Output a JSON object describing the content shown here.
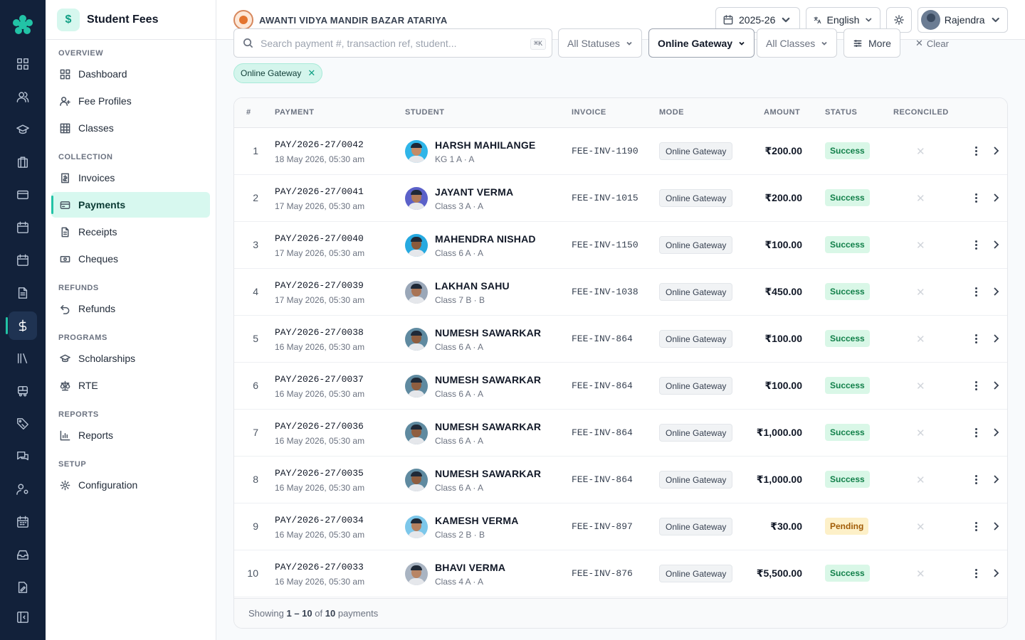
{
  "app": {
    "section_title": "Student Fees",
    "section_icon": "$"
  },
  "school": {
    "name": "AWANTI VIDYA MANDIR BAZAR ATARIYA"
  },
  "header": {
    "year": "2025-26",
    "language": "English",
    "user": "Rajendra"
  },
  "rail_icons": [
    "grid-icon",
    "users-icon",
    "graduation-cap-icon",
    "building-icon",
    "card-icon",
    "calendar-icon",
    "calendar-check-icon",
    "document-icon",
    "dollar-icon",
    "library-icon",
    "bus-icon",
    "tag-icon",
    "chat-icon",
    "user-gear-icon",
    "timetable-icon",
    "inbox-icon",
    "file-edit-icon",
    "collapse-icon"
  ],
  "sidebar": {
    "sections": {
      "overview": "OVERVIEW",
      "collection": "COLLECTION",
      "refunds": "REFUNDS",
      "programs": "PROGRAMS",
      "reports": "REPORTS",
      "setup": "SETUP"
    },
    "items": {
      "dashboard": "Dashboard",
      "fee_profiles": "Fee Profiles",
      "classes": "Classes",
      "invoices": "Invoices",
      "payments": "Payments",
      "receipts": "Receipts",
      "cheques": "Cheques",
      "refunds": "Refunds",
      "scholarships": "Scholarships",
      "rte": "RTE",
      "reports": "Reports",
      "configuration": "Configuration"
    }
  },
  "filters": {
    "search_placeholder": "Search payment #, transaction ref, student...",
    "search_shortcut": "⌘K",
    "status": "All Statuses",
    "mode": "Online Gateway",
    "classes": "All Classes",
    "more": "More",
    "clear": "Clear",
    "active_chip": "Online Gateway"
  },
  "table": {
    "columns": {
      "num": "#",
      "payment": "PAYMENT",
      "student": "STUDENT",
      "invoice": "INVOICE",
      "mode": "MODE",
      "amount": "AMOUNT",
      "status": "STATUS",
      "reconciled": "RECONCILED"
    },
    "rows": [
      {
        "n": "1",
        "pay": "PAY/2026-27/0042",
        "date": "18 May 2026, 05:30 am",
        "name": "HARSH MAHILANGE",
        "cls": "KG 1 A · A",
        "inv": "FEE-INV-1190",
        "mode": "Online Gateway",
        "amt": "₹200.00",
        "status": "Success",
        "bg": "#2fb5e8",
        "skin": "#c48c67"
      },
      {
        "n": "2",
        "pay": "PAY/2026-27/0041",
        "date": "17 May 2026, 05:30 am",
        "name": "JAYANT VERMA",
        "cls": "Class 3 A · A",
        "inv": "FEE-INV-1015",
        "mode": "Online Gateway",
        "amt": "₹200.00",
        "status": "Success",
        "bg": "#5b61c9",
        "skin": "#b07a58"
      },
      {
        "n": "3",
        "pay": "PAY/2026-27/0040",
        "date": "17 May 2026, 05:30 am",
        "name": "MAHENDRA NISHAD",
        "cls": "Class 6 A · A",
        "inv": "FEE-INV-1150",
        "mode": "Online Gateway",
        "amt": "₹100.00",
        "status": "Success",
        "bg": "#26a9e0",
        "skin": "#8a5a3c"
      },
      {
        "n": "4",
        "pay": "PAY/2026-27/0039",
        "date": "17 May 2026, 05:30 am",
        "name": "LAKHAN SAHU",
        "cls": "Class 7 B · B",
        "inv": "FEE-INV-1038",
        "mode": "Online Gateway",
        "amt": "₹450.00",
        "status": "Success",
        "bg": "#9aa7b8",
        "skin": "#a97455"
      },
      {
        "n": "5",
        "pay": "PAY/2026-27/0038",
        "date": "16 May 2026, 05:30 am",
        "name": "NUMESH SAWARKAR",
        "cls": "Class 6 A · A",
        "inv": "FEE-INV-864",
        "mode": "Online Gateway",
        "amt": "₹100.00",
        "status": "Success",
        "bg": "#5f8aa0",
        "skin": "#8f5e40"
      },
      {
        "n": "6",
        "pay": "PAY/2026-27/0037",
        "date": "16 May 2026, 05:30 am",
        "name": "NUMESH SAWARKAR",
        "cls": "Class 6 A · A",
        "inv": "FEE-INV-864",
        "mode": "Online Gateway",
        "amt": "₹100.00",
        "status": "Success",
        "bg": "#5f8aa0",
        "skin": "#8f5e40"
      },
      {
        "n": "7",
        "pay": "PAY/2026-27/0036",
        "date": "16 May 2026, 05:30 am",
        "name": "NUMESH SAWARKAR",
        "cls": "Class 6 A · A",
        "inv": "FEE-INV-864",
        "mode": "Online Gateway",
        "amt": "₹1,000.00",
        "status": "Success",
        "bg": "#5f8aa0",
        "skin": "#8f5e40"
      },
      {
        "n": "8",
        "pay": "PAY/2026-27/0035",
        "date": "16 May 2026, 05:30 am",
        "name": "NUMESH SAWARKAR",
        "cls": "Class 6 A · A",
        "inv": "FEE-INV-864",
        "mode": "Online Gateway",
        "amt": "₹1,000.00",
        "status": "Success",
        "bg": "#5f8aa0",
        "skin": "#8f5e40"
      },
      {
        "n": "9",
        "pay": "PAY/2026-27/0034",
        "date": "16 May 2026, 05:30 am",
        "name": "KAMESH VERMA",
        "cls": "Class 2 B · B",
        "inv": "FEE-INV-897",
        "mode": "Online Gateway",
        "amt": "₹30.00",
        "status": "Pending",
        "bg": "#7cc7ea",
        "skin": "#b58160"
      },
      {
        "n": "10",
        "pay": "PAY/2026-27/0033",
        "date": "16 May 2026, 05:30 am",
        "name": "BHAVI VERMA",
        "cls": "Class 4 A · A",
        "inv": "FEE-INV-876",
        "mode": "Online Gateway",
        "amt": "₹5,500.00",
        "status": "Success",
        "bg": "#a9b4c2",
        "skin": "#b88565"
      }
    ],
    "footer": {
      "prefix": "Showing",
      "range": "1 – 10",
      "of": "of",
      "total": "10",
      "suffix": "payments"
    }
  }
}
